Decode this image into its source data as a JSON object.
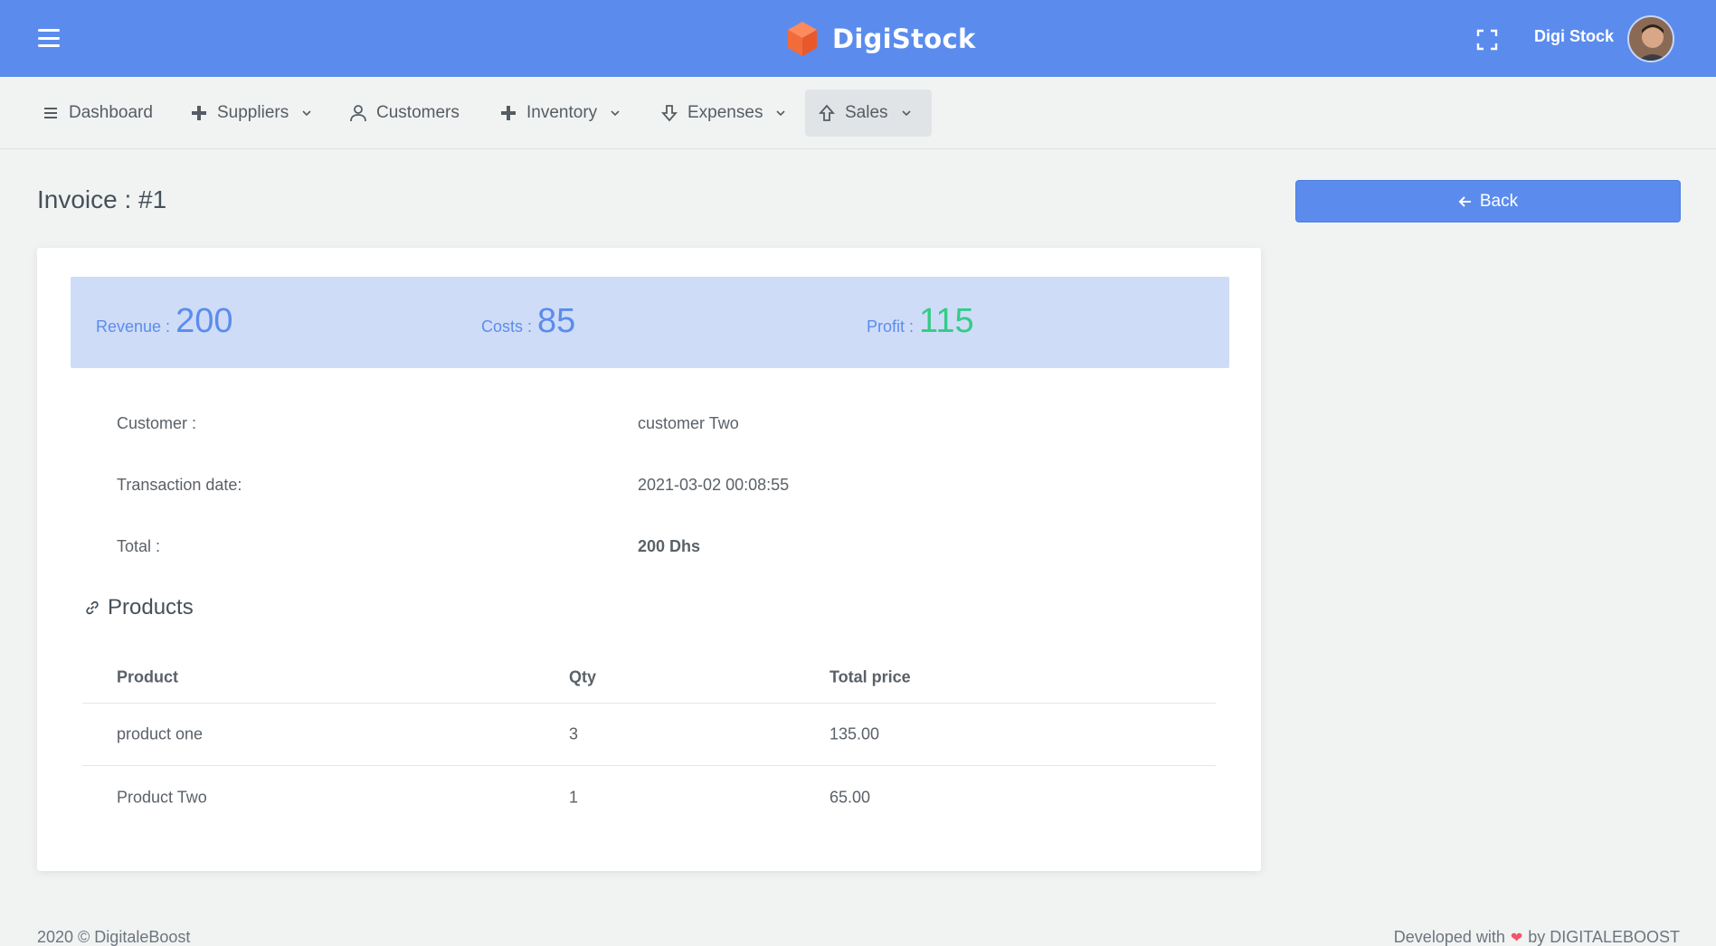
{
  "colors": {
    "primary": "#5b8ced",
    "profit": "#33cc88",
    "stats_bg": "#cfdcf7"
  },
  "header": {
    "brand_name": "DigiStock",
    "user_name": "Digi Stock",
    "icons": [
      "menu-icon",
      "cube-logo-icon",
      "fullscreen-icon",
      "avatar"
    ]
  },
  "nav": {
    "items": [
      {
        "label": "Dashboard",
        "icon": "list-icon",
        "dropdown": false
      },
      {
        "label": "Suppliers",
        "icon": "plus-icon",
        "dropdown": true
      },
      {
        "label": "Customers",
        "icon": "user-icon",
        "dropdown": false
      },
      {
        "label": "Inventory",
        "icon": "plus-icon",
        "dropdown": true
      },
      {
        "label": "Expenses",
        "icon": "arrow-down-icon",
        "dropdown": true
      },
      {
        "label": "Sales",
        "icon": "arrow-up-icon",
        "dropdown": true,
        "active": true
      }
    ]
  },
  "page": {
    "title": "Invoice : #1",
    "back_label": "Back"
  },
  "stats": {
    "revenue_label": "Revenue :",
    "revenue_value": "200",
    "costs_label": "Costs :",
    "costs_value": "85",
    "profit_label": "Profit :",
    "profit_value": "115"
  },
  "details": {
    "customer_label": "Customer :",
    "customer_value": "customer Two",
    "date_label": "Transaction date:",
    "date_value": "2021-03-02 00:08:55",
    "total_label": "Total :",
    "total_value": "200 Dhs"
  },
  "products": {
    "heading": "Products",
    "columns": [
      "Product",
      "Qty",
      "Total price"
    ],
    "rows": [
      {
        "product": "product one",
        "qty": "3",
        "total": "135.00"
      },
      {
        "product": "Product Two",
        "qty": "1",
        "total": "65.00"
      }
    ]
  },
  "footer": {
    "left": "2020 © DigitaleBoost",
    "right_prefix": "Developed with",
    "right_suffix": "by DIGITALEBOOST"
  }
}
